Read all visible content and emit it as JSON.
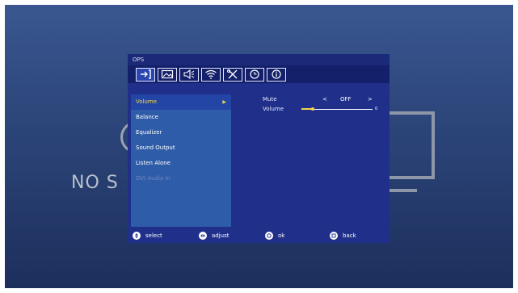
{
  "background": {
    "no_signal_text": "NO S"
  },
  "menu": {
    "title": "OPS",
    "tabs": [
      {
        "icon": "input-icon",
        "active": true
      },
      {
        "icon": "picture-icon",
        "active": false
      },
      {
        "icon": "sound-icon",
        "active": false
      },
      {
        "icon": "network-icon",
        "active": false
      },
      {
        "icon": "tools-icon",
        "active": false
      },
      {
        "icon": "timer-icon",
        "active": false
      },
      {
        "icon": "info-icon",
        "active": false
      }
    ],
    "left_items": [
      {
        "label": "Volume",
        "selected": true,
        "disabled": false
      },
      {
        "label": "Balance",
        "selected": false,
        "disabled": false
      },
      {
        "label": "Equalizer",
        "selected": false,
        "disabled": false
      },
      {
        "label": "Sound Output",
        "selected": false,
        "disabled": false
      },
      {
        "label": "Listen Alone",
        "selected": false,
        "disabled": false
      },
      {
        "label": "DVI Audio In",
        "selected": false,
        "disabled": true
      }
    ],
    "settings": {
      "mute": {
        "label": "Mute",
        "value": "OFF",
        "prev": "<",
        "next": ">"
      },
      "volume": {
        "label": "Volume",
        "value": 0,
        "value_text": "0",
        "min": 0,
        "max": 100
      }
    },
    "footer": {
      "select": "select",
      "adjust": "adjust",
      "ok": "ok",
      "back": "back"
    }
  },
  "colors": {
    "accent": "#f6d44a",
    "menu_bg": "#1f2f8a",
    "left_panel": "#2f5ca8"
  }
}
